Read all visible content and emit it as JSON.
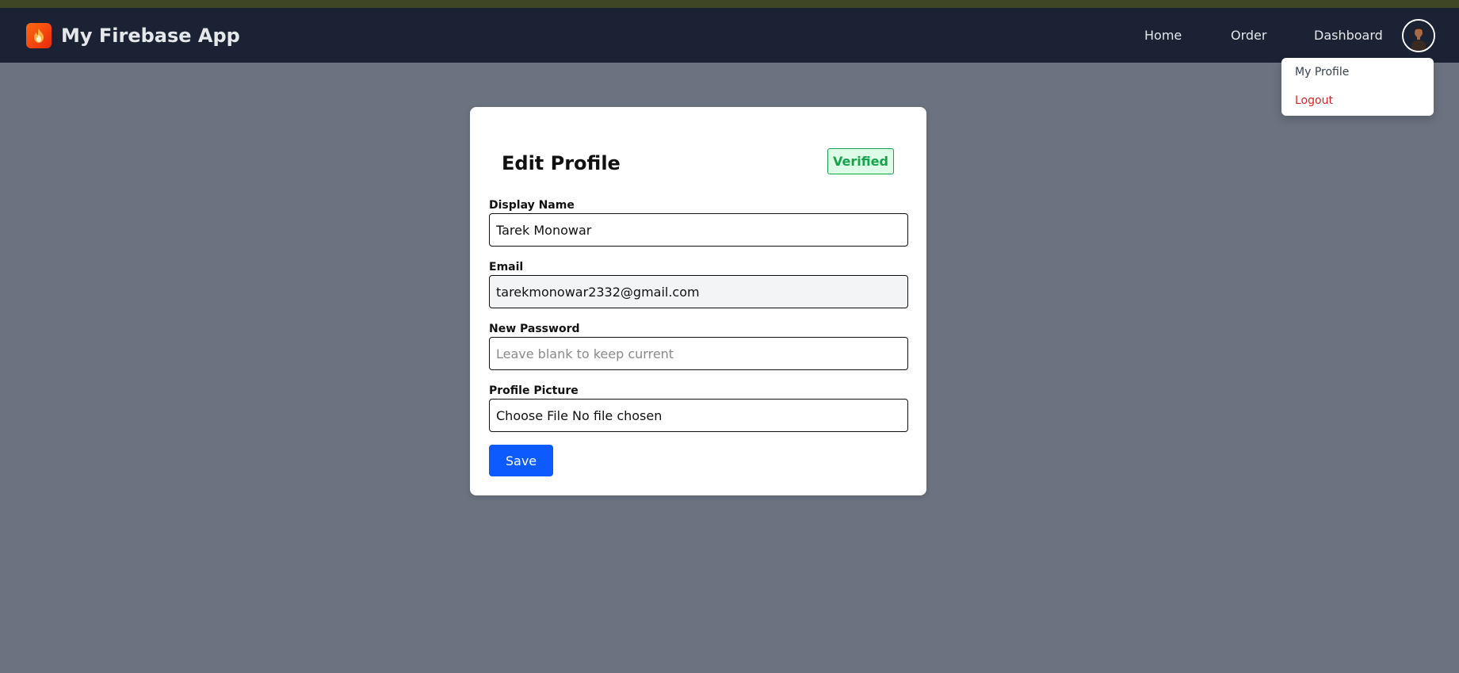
{
  "navbar": {
    "brand_title": "My Firebase App",
    "brand_icon": "flame-icon",
    "links": {
      "home": "Home",
      "order": "Order",
      "dashboard": "Dashboard"
    },
    "avatar_icon": "user-avatar"
  },
  "dropdown": {
    "my_profile": "My Profile",
    "logout": "Logout"
  },
  "profile_form": {
    "title": "Edit Profile",
    "badge": "Verified",
    "display_name_label": "Display Name",
    "display_name_value": "Tarek Monowar",
    "email_label": "Email",
    "email_value": "tarekmonowar2332@gmail.com",
    "password_label": "New Password",
    "password_placeholder": "Leave blank to keep current",
    "picture_label": "Profile Picture",
    "picture_value": "Choose File No file chosen",
    "save_label": "Save"
  },
  "colors": {
    "page_background": "#6b7280",
    "navbar_background": "#1a2234",
    "accent": "#0d5bff",
    "verified": "#16a34a",
    "logout": "#dc2626"
  }
}
